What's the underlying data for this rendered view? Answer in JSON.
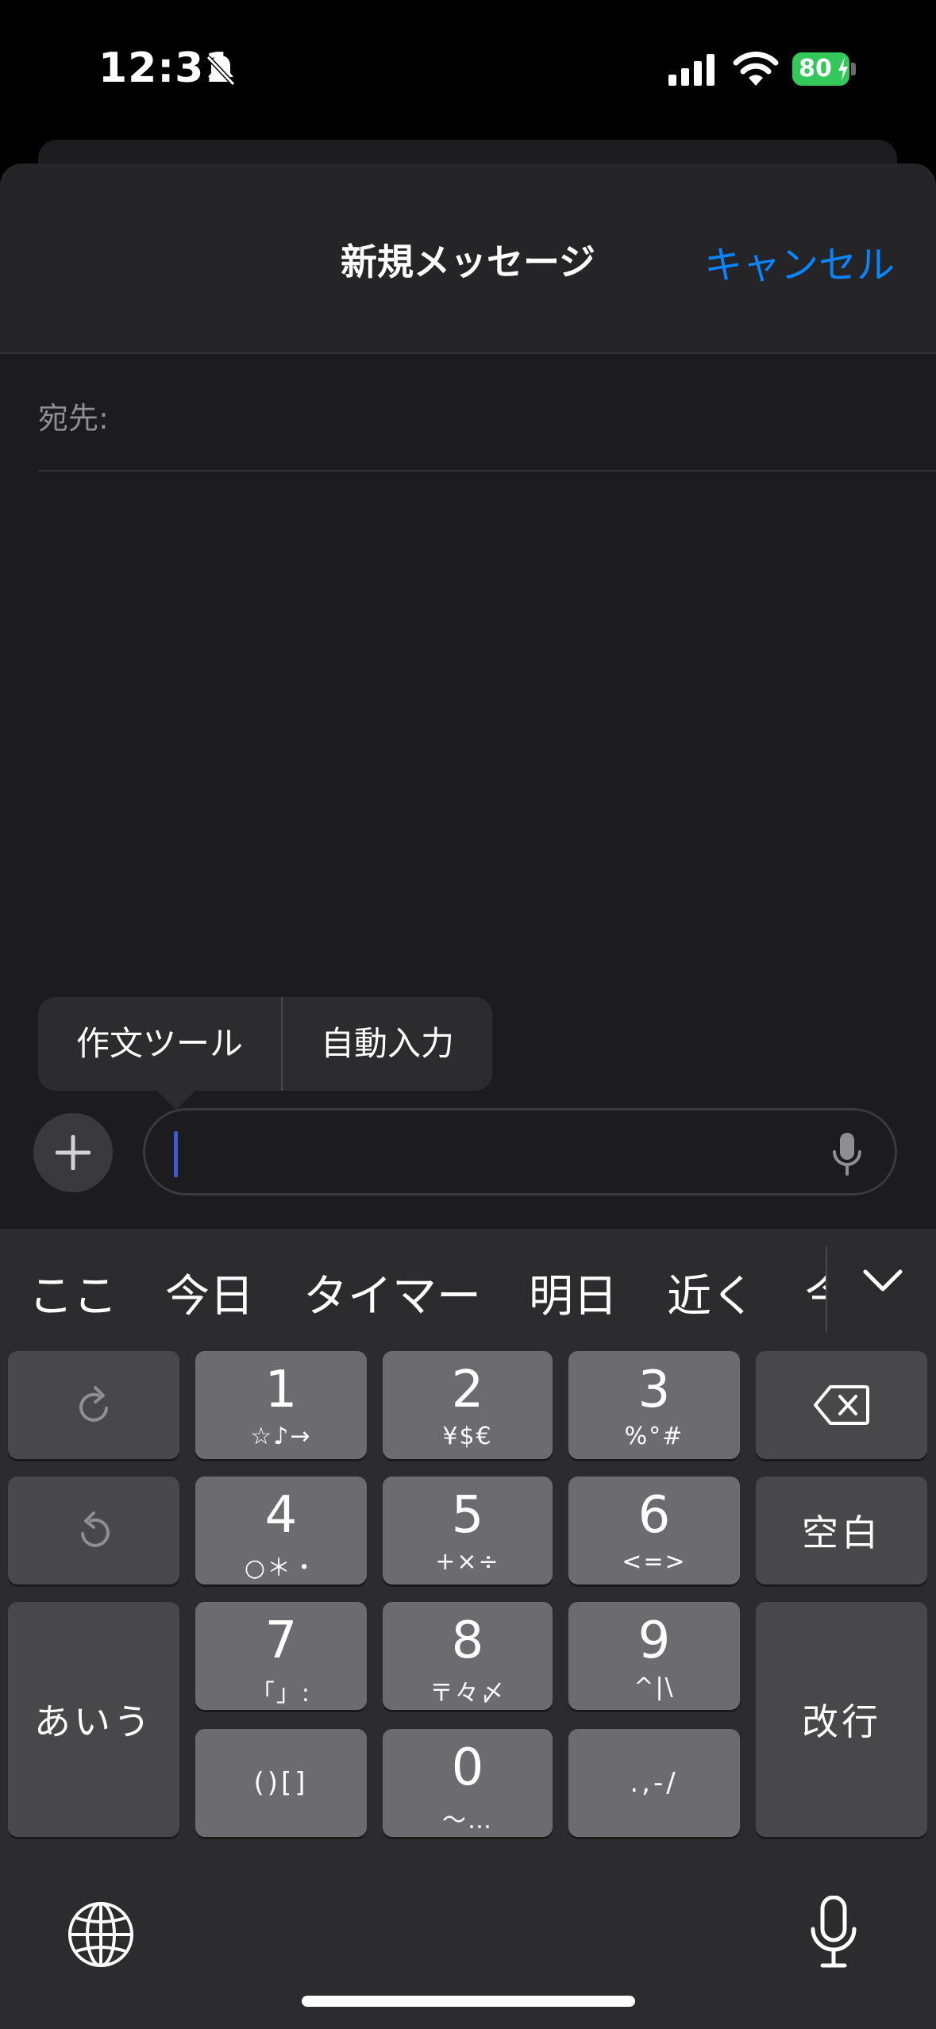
{
  "status_bar": {
    "time": "12:31",
    "battery_percent": "80",
    "icons": [
      "bell-slash-icon",
      "cellular-signal-icon",
      "wifi-icon",
      "battery-charging-icon"
    ]
  },
  "sheet": {
    "title": "新規メッセージ",
    "cancel_label": "キャンセル",
    "to_label": "宛先:"
  },
  "popup_menu": {
    "items": [
      "作文ツール",
      "自動入力"
    ]
  },
  "compose": {
    "text": "",
    "icons": [
      "plus-icon",
      "microphone-icon"
    ]
  },
  "keyboard": {
    "candidates": [
      "ここ",
      "今日",
      "タイマー",
      "明日",
      "近く",
      "今"
    ],
    "keys": {
      "1": {
        "main": "1",
        "sub": "☆♪→"
      },
      "2": {
        "main": "2",
        "sub": "¥$€"
      },
      "3": {
        "main": "3",
        "sub": "%°#"
      },
      "4": {
        "main": "4",
        "sub": "○＊・"
      },
      "5": {
        "main": "5",
        "sub": "+×÷"
      },
      "6": {
        "main": "6",
        "sub": "<=>"
      },
      "7": {
        "main": "7",
        "sub": "「」:"
      },
      "8": {
        "main": "8",
        "sub": "〒々〆"
      },
      "9": {
        "main": "9",
        "sub": "^|\\"
      },
      "0": {
        "main": "0",
        "sub": "〜…"
      },
      "brackets": "()[]",
      "punct": ".,-/",
      "space": "空白",
      "return": "改行",
      "kana": "あいう"
    },
    "icons": [
      "redo-icon",
      "undo-icon",
      "delete-icon",
      "globe-icon",
      "dictation-mic-icon",
      "chevron-down-icon"
    ]
  }
}
